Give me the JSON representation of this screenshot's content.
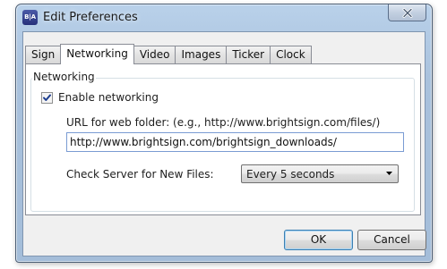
{
  "window": {
    "title": "Edit Preferences",
    "app_icon_text": "B|A",
    "close_icon": "close-icon"
  },
  "tabs": [
    {
      "label": "Sign",
      "active": false
    },
    {
      "label": "Networking",
      "active": true
    },
    {
      "label": "Video",
      "active": false
    },
    {
      "label": "Images",
      "active": false
    },
    {
      "label": "Ticker",
      "active": false
    },
    {
      "label": "Clock",
      "active": false
    }
  ],
  "networking": {
    "group_title": "Networking",
    "enable_label": "Enable networking",
    "enable_checked": true,
    "url_label": "URL for web folder: (e.g., http://www.brightsign.com/files/)",
    "url_value": "http://www.brightsign.com/brightsign_downloads/",
    "server_label": "Check Server for New Files:",
    "server_value": "Every 5 seconds"
  },
  "buttons": {
    "ok": "OK",
    "cancel": "Cancel"
  },
  "colors": {
    "titlebar": "#b9d1ea",
    "focus_border": "#7a9cd3",
    "default_button_border": "#3c7fb1"
  }
}
